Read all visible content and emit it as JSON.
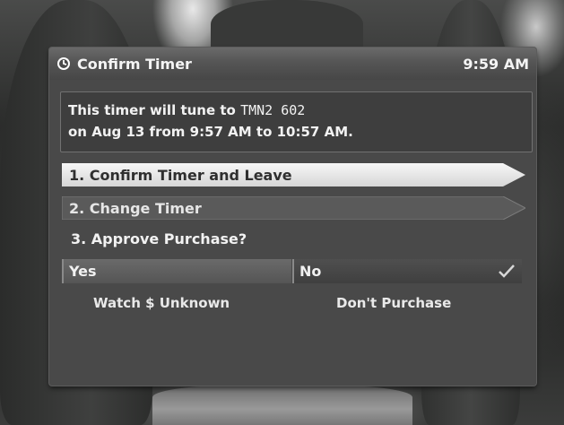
{
  "dialog": {
    "title": "Confirm Timer",
    "time": "9:59 AM",
    "title_icon": "timer-icon"
  },
  "info": {
    "line1_prefix": "This timer will tune to ",
    "line1_channel": "TMN2 602",
    "line2": "on Aug 13 from 9:57 AM to 10:57 AM."
  },
  "menu": {
    "items": [
      {
        "label": "1.  Confirm Timer and Leave",
        "selected": true
      },
      {
        "label": "2.  Change Timer",
        "selected": false
      }
    ],
    "question": "3.  Approve Purchase?"
  },
  "purchase": {
    "yes_label": "Yes",
    "no_label": "No",
    "selected": "No",
    "check_icon": "checkmark-icon",
    "yes_sub": "Watch $ Unknown",
    "no_sub": "Don't Purchase"
  },
  "colors": {
    "selected_item": "#e9e9e9",
    "unselected_item": "#5a5a5a",
    "panel": "#494949"
  }
}
